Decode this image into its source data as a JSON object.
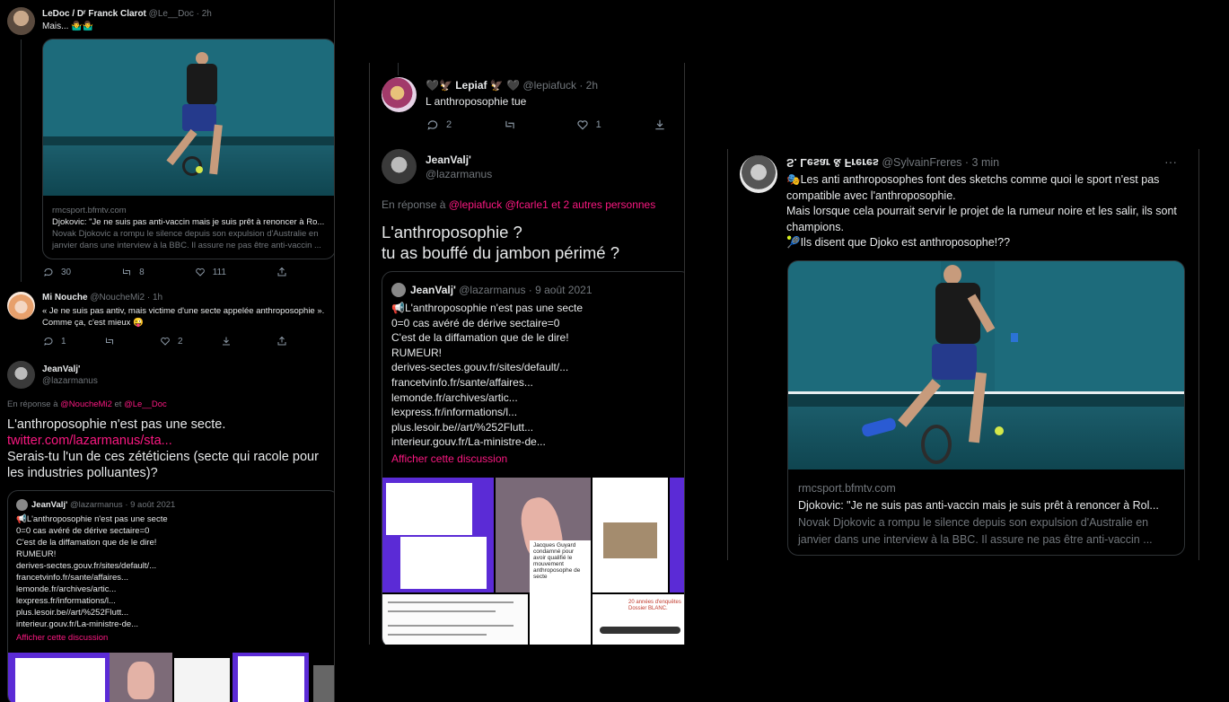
{
  "left": {
    "tweet1": {
      "name": "LeDoc / Dʳ Franck Clarot",
      "handle": "@Le__Doc · 2h",
      "text": "Mais... 🤷‍♂️🤷‍♂️",
      "card": {
        "domain": "rmcsport.bfmtv.com",
        "title": "Djokovic: \"Je ne suis pas anti-vaccin mais je suis prêt à renoncer à Ro...",
        "desc": "Novak Djokovic a rompu le silence depuis son expulsion d'Australie en janvier dans une interview à la BBC. Il assure ne pas être anti-vaccin ..."
      },
      "replies": "30",
      "retweets": "8",
      "likes": "111"
    },
    "tweet2": {
      "name": "Mi Nouche",
      "handle": "@NoucheMi2 · 1h",
      "text": "« Je ne suis pas antiv, mais victime d'une secte appelée anthroposophie ».\nComme ça, c'est mieux 😜",
      "replies": "1",
      "likes": "2"
    },
    "tweet3": {
      "name": "JeanValj'",
      "handle": "@lazarmanus",
      "reply_prefix": "En réponse à",
      "reply_user1": "@NoucheMi2",
      "reply_and": "et",
      "reply_user2": "@Le__Doc",
      "text1": "L'anthroposophie n'est pas une secte.",
      "link": "twitter.com/lazarmanus/sta...",
      "text2": "Serais-tu l'un de ces zététiciens (secte qui racole pour les industries polluantes)?",
      "quote": {
        "name": "JeanValj'",
        "meta": "@lazarmanus · 9 août 2021",
        "text": "📢L'anthroposophie n'est pas une secte\n0=0 cas avéré de dérive sectaire=0\nC'est de la diffamation que de le dire!\nRUMEUR!\nderives-sectes.gouv.fr/sites/default/...\nfrancetvinfo.fr/sante/affaires...\nlemonde.fr/archives/artic...\nlexpress.fr/informations/l...\nplus.lesoir.be//art/%252Flutt...\ninterieur.gouv.fr/La-ministre-de...",
        "show_thread": "Afficher cette discussion"
      }
    }
  },
  "middle": {
    "tweet1": {
      "name": "🖤🦅 Lepiaf 🦅 🖤",
      "handle": "@lepiafuck · 2h",
      "text": "L anthroposophie tue",
      "replies": "2",
      "likes": "1"
    },
    "tweet2": {
      "name": "JeanValj'",
      "handle": "@lazarmanus",
      "reply_prefix": "En réponse à",
      "reply_users": "@lepiafuck @fcarle1",
      "reply_and": "et 2 autres personnes",
      "text": "L'anthroposophie ?\ntu as bouffé du jambon périmé ?",
      "quote": {
        "name": "JeanValj'",
        "meta": "@lazarmanus · 9 août 2021",
        "text": "📢L'anthroposophie n'est pas une secte\n0=0 cas avéré de dérive sectaire=0\nC'est de la diffamation que de le dire!\nRUMEUR!\nderives-sectes.gouv.fr/sites/default/...\nfrancetvinfo.fr/sante/affaires...\nlemonde.fr/archives/artic...\nlexpress.fr/informations/l...\nplus.lesoir.be//art/%252Flutt...\ninterieur.gouv.fr/La-ministre-de...",
        "show_thread": "Afficher cette discussion"
      },
      "thumb_texts": {
        "headline": "Jacques Guyard condamné pour avoir qualifié le mouvement anthroposophe de secte",
        "dossier": "20 années d'enquêtes Dossier BLANC."
      }
    }
  },
  "right": {
    "tweet": {
      "name": "S. Lesar & Freres",
      "handle": "@SylvainFreres · 3 min",
      "more": "···",
      "text": "🎭Les anti anthroposophes font des sketchs comme quoi le sport n'est pas compatible avec l'anthroposophie.\nMais lorsque cela pourrait servir le projet de la rumeur noire et les salir, ils sont champions.\n🎾Ils disent que Djoko est anthroposophe!??",
      "card": {
        "domain": "rmcsport.bfmtv.com",
        "title": "Djokovic: \"Je ne suis pas anti-vaccin mais je suis prêt à renoncer à Rol...",
        "desc": "Novak Djokovic a rompu le silence depuis son expulsion d'Australie en janvier dans une interview à la BBC. Il assure ne pas être anti-vaccin ..."
      }
    }
  },
  "colors": {
    "background": "#000000",
    "text": "#e7e9ea",
    "muted": "#71767b",
    "accent_pink": "#f91880",
    "court_teal": "#1e6b7a"
  }
}
